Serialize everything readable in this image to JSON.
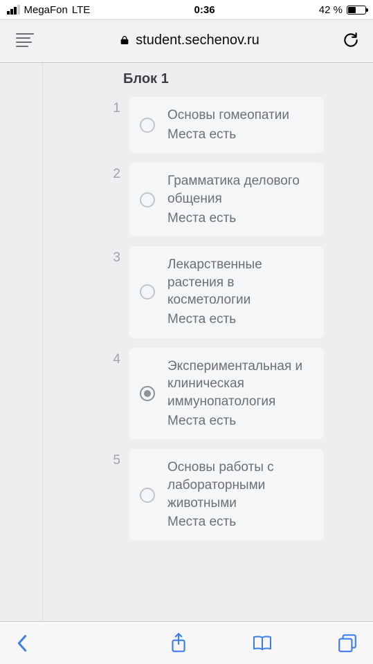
{
  "status": {
    "carrier": "MegaFon",
    "network": "LTE",
    "time": "0:36",
    "battery_pct": "42 %"
  },
  "browser": {
    "url": "student.sechenov.ru"
  },
  "page": {
    "block_title": "Блок 1",
    "availability_text": "Места есть",
    "options": [
      {
        "num": "1",
        "title": "Основы гомеопатии",
        "selected": false
      },
      {
        "num": "2",
        "title": "Грамматика делового общения",
        "selected": false
      },
      {
        "num": "3",
        "title": "Лекарственные растения в косметологии",
        "selected": false
      },
      {
        "num": "4",
        "title": "Экспериментальная и клиническая иммунопатология",
        "selected": true
      },
      {
        "num": "5",
        "title": "Основы работы с лабораторными животными",
        "selected": false
      }
    ]
  }
}
